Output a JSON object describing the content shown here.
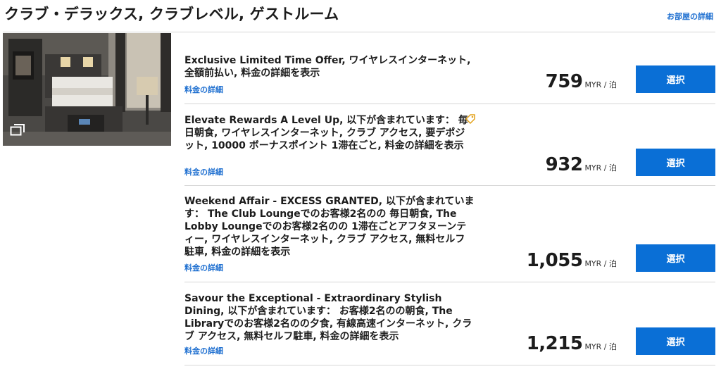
{
  "room": {
    "title": "クラブ・デラックス, クラブレベル, ゲストルーム",
    "details_link": "お部屋の詳細"
  },
  "rates": [
    {
      "description": "Exclusive Limited Time Offer, ワイヤレスインターネット, 全額前払い, 料金の詳細を表示",
      "details_link": "料金の詳細",
      "price": "759",
      "unit": "MYR / 泊",
      "select_label": "選択"
    },
    {
      "description": "Elevate Rewards A Level Up, 以下が含まれています： 毎日朝食, ワイヤレスインターネット, クラブ アクセス, 要デポジット, 10000 ボーナスポイント 1滞在ごと, 料金の詳細を表示",
      "details_link": "料金の詳細",
      "price": "932",
      "unit": "MYR / 泊",
      "select_label": "選択",
      "icon": "tag-icon"
    },
    {
      "description": "Weekend Affair - EXCESS GRANTED, 以下が含まれています： The Club Loungeでのお客様2名のの 毎日朝食, The Lobby Loungeでのお客様2名のの 1滞在ごとアフタヌーンティー, ワイヤレスインターネット, クラブ アクセス, 無料セルフ駐車, 料金の詳細を表示",
      "details_link": "料金の詳細",
      "price": "1,055",
      "unit": "MYR / 泊",
      "select_label": "選択"
    },
    {
      "description": "Savour the Exceptional - Extraordinary Stylish Dining, 以下が含まれています： お客様2名のの朝食, The Libraryでのお客様2名のの夕食, 有線高速インターネット, クラブ アクセス, 無料セルフ駐車, 料金の詳細を表示",
      "details_link": "料金の詳細",
      "price": "1,215",
      "unit": "MYR / 泊",
      "select_label": "選択"
    }
  ],
  "colors": {
    "accent": "#0a6fd6",
    "link": "#1e6fd0",
    "tag_icon": "#e3a21a"
  },
  "icons": {
    "gallery": "gallery-icon",
    "offer_tag": "tag-icon"
  }
}
